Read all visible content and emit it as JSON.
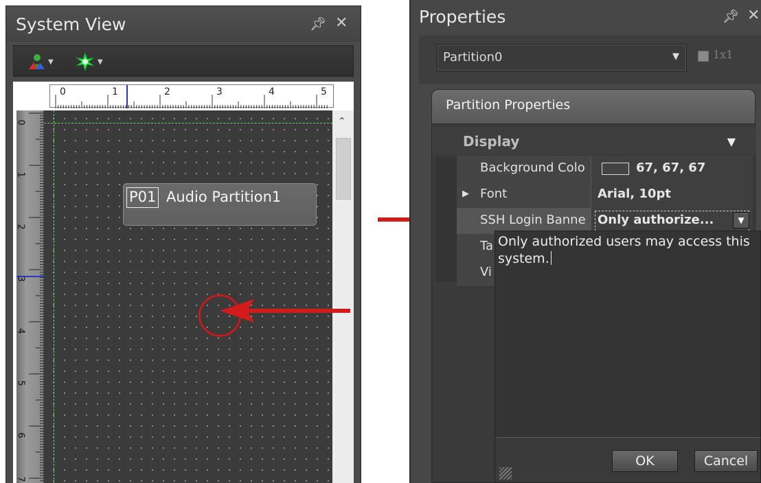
{
  "system_view": {
    "title": "System View",
    "toolbar": {
      "btn1_icon": "users-icon",
      "btn2_icon": "star-burst-icon"
    },
    "ruler_top_labels": [
      "0",
      "1",
      "2",
      "3",
      "4",
      "5"
    ],
    "ruler_left_labels": [
      "0",
      "1",
      "2",
      "3",
      "4",
      "5",
      "6",
      "7"
    ],
    "partition": {
      "id": "P01",
      "name": "Audio Partition1"
    }
  },
  "properties": {
    "title": "Properties",
    "selector": {
      "value": "Partition0"
    },
    "option_label": "1x1",
    "tab": "Partition Properties",
    "category": "Display",
    "rows": [
      {
        "name": "Background Colo",
        "value": "67, 67, 67"
      },
      {
        "name": "Font",
        "value": "Arial, 10pt"
      },
      {
        "name": "SSH Login Banne",
        "value": "Only authorize..."
      },
      {
        "name": "Ta",
        "value": ""
      },
      {
        "name": "Vi",
        "value": ""
      }
    ],
    "popup": {
      "text": "Only authorized users may access this system.",
      "ok": "OK",
      "cancel": "Cancel"
    }
  },
  "colors": {
    "annotation_red": "#d41b1b",
    "guide_green": "#68d66a",
    "panel_bg": "#474747"
  }
}
